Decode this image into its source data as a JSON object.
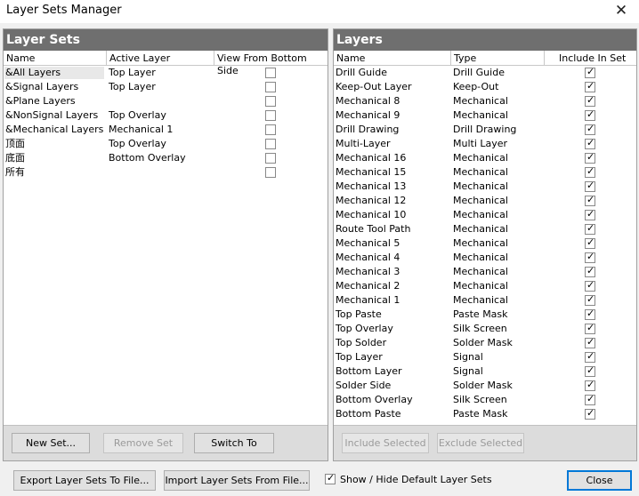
{
  "window": {
    "title": "Layer Sets Manager",
    "close_glyph": "✕"
  },
  "layer_sets": {
    "header": "Layer Sets",
    "columns": [
      "Name",
      "Active Layer",
      "View From Bottom Side"
    ],
    "rows": [
      {
        "name": "&All Layers",
        "active": "Top Layer",
        "bottom": false
      },
      {
        "name": "&Signal Layers",
        "active": "Top Layer",
        "bottom": false
      },
      {
        "name": "&Plane Layers",
        "active": "",
        "bottom": false
      },
      {
        "name": "&NonSignal Layers",
        "active": "Top Overlay",
        "bottom": false
      },
      {
        "name": "&Mechanical Layers",
        "active": "Mechanical 1",
        "bottom": false
      },
      {
        "name": "顶面",
        "active": "Top Overlay",
        "bottom": false
      },
      {
        "name": "底面",
        "active": "Bottom Overlay",
        "bottom": false
      },
      {
        "name": "所有",
        "active": "",
        "bottom": false
      }
    ],
    "buttons": {
      "new_set": "New Set...",
      "remove_set": "Remove Set",
      "switch_to": "Switch To"
    }
  },
  "layers": {
    "header": "Layers",
    "columns": [
      "Name",
      "Type",
      "Include In Set"
    ],
    "rows": [
      {
        "name": "Drill Guide",
        "type": "Drill Guide",
        "include": true
      },
      {
        "name": "Keep-Out Layer",
        "type": "Keep-Out",
        "include": true
      },
      {
        "name": "Mechanical 8",
        "type": "Mechanical",
        "include": true
      },
      {
        "name": "Mechanical 9",
        "type": "Mechanical",
        "include": true
      },
      {
        "name": "Drill Drawing",
        "type": "Drill Drawing",
        "include": true
      },
      {
        "name": "Multi-Layer",
        "type": "Multi Layer",
        "include": true
      },
      {
        "name": "Mechanical 16",
        "type": "Mechanical",
        "include": true
      },
      {
        "name": "Mechanical 15",
        "type": "Mechanical",
        "include": true
      },
      {
        "name": "Mechanical 13",
        "type": "Mechanical",
        "include": true
      },
      {
        "name": "Mechanical 12",
        "type": "Mechanical",
        "include": true
      },
      {
        "name": "Mechanical 10",
        "type": "Mechanical",
        "include": true
      },
      {
        "name": "Route Tool Path",
        "type": "Mechanical",
        "include": true
      },
      {
        "name": "Mechanical 5",
        "type": "Mechanical",
        "include": true
      },
      {
        "name": "Mechanical 4",
        "type": "Mechanical",
        "include": true
      },
      {
        "name": "Mechanical 3",
        "type": "Mechanical",
        "include": true
      },
      {
        "name": "Mechanical 2",
        "type": "Mechanical",
        "include": true
      },
      {
        "name": "Mechanical 1",
        "type": "Mechanical",
        "include": true
      },
      {
        "name": "Top Paste",
        "type": "Paste Mask",
        "include": true
      },
      {
        "name": "Top Overlay",
        "type": "Silk Screen",
        "include": true
      },
      {
        "name": "Top Solder",
        "type": "Solder Mask",
        "include": true
      },
      {
        "name": "Top Layer",
        "type": "Signal",
        "include": true
      },
      {
        "name": "Bottom Layer",
        "type": "Signal",
        "include": true
      },
      {
        "name": "Solder Side",
        "type": "Solder Mask",
        "include": true
      },
      {
        "name": "Bottom Overlay",
        "type": "Silk Screen",
        "include": true
      },
      {
        "name": "Bottom Paste",
        "type": "Paste Mask",
        "include": true
      }
    ],
    "buttons": {
      "include_selected": "Include Selected",
      "exclude_selected": "Exclude Selected"
    }
  },
  "footer": {
    "export": "Export Layer Sets To File...",
    "import": "Import Layer Sets From File...",
    "show_hide_label": "Show / Hide Default Layer Sets",
    "show_hide_checked": true,
    "close": "Close"
  },
  "colors": {
    "panel_header": "#6f6f6f",
    "focus_border": "#0078d7"
  }
}
